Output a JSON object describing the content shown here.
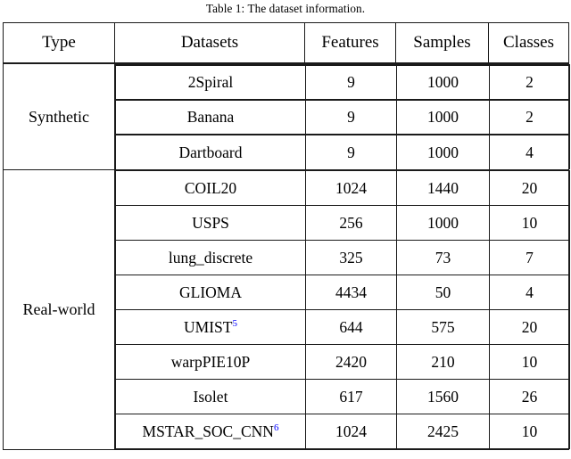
{
  "caption": {
    "label": "Table 1:",
    "text": "The dataset information."
  },
  "table": {
    "columns": [
      "Type",
      "Datasets",
      "Features",
      "Samples",
      "Classes"
    ],
    "groups": [
      {
        "type": "Synthetic",
        "rows": [
          {
            "dataset": "2Spiral",
            "footnote": "",
            "features": "9",
            "samples": "1000",
            "classes": "2"
          },
          {
            "dataset": "Banana",
            "footnote": "",
            "features": "9",
            "samples": "1000",
            "classes": "2"
          },
          {
            "dataset": "Dartboard",
            "footnote": "",
            "features": "9",
            "samples": "1000",
            "classes": "4"
          }
        ]
      },
      {
        "type": "Real-world",
        "rows": [
          {
            "dataset": "COIL20",
            "footnote": "",
            "features": "1024",
            "samples": "1440",
            "classes": "20"
          },
          {
            "dataset": "USPS",
            "footnote": "",
            "features": "256",
            "samples": "1000",
            "classes": "10"
          },
          {
            "dataset": "lung_discrete",
            "footnote": "",
            "features": "325",
            "samples": "73",
            "classes": "7"
          },
          {
            "dataset": "GLIOMA",
            "footnote": "",
            "features": "4434",
            "samples": "50",
            "classes": "4"
          },
          {
            "dataset": "UMIST",
            "footnote": "5",
            "features": "644",
            "samples": "575",
            "classes": "20"
          },
          {
            "dataset": "warpPIE10P",
            "footnote": "",
            "features": "2420",
            "samples": "210",
            "classes": "10"
          },
          {
            "dataset": "Isolet",
            "footnote": "",
            "features": "617",
            "samples": "1560",
            "classes": "26"
          },
          {
            "dataset": "MSTAR_SOC_CNN",
            "footnote": "6",
            "features": "1024",
            "samples": "2425",
            "classes": "10"
          }
        ]
      }
    ]
  },
  "colors": {
    "rule": "#1a1a1a",
    "text": "#000000",
    "footnote_link": "#0000ff",
    "background": "#ffffff"
  }
}
